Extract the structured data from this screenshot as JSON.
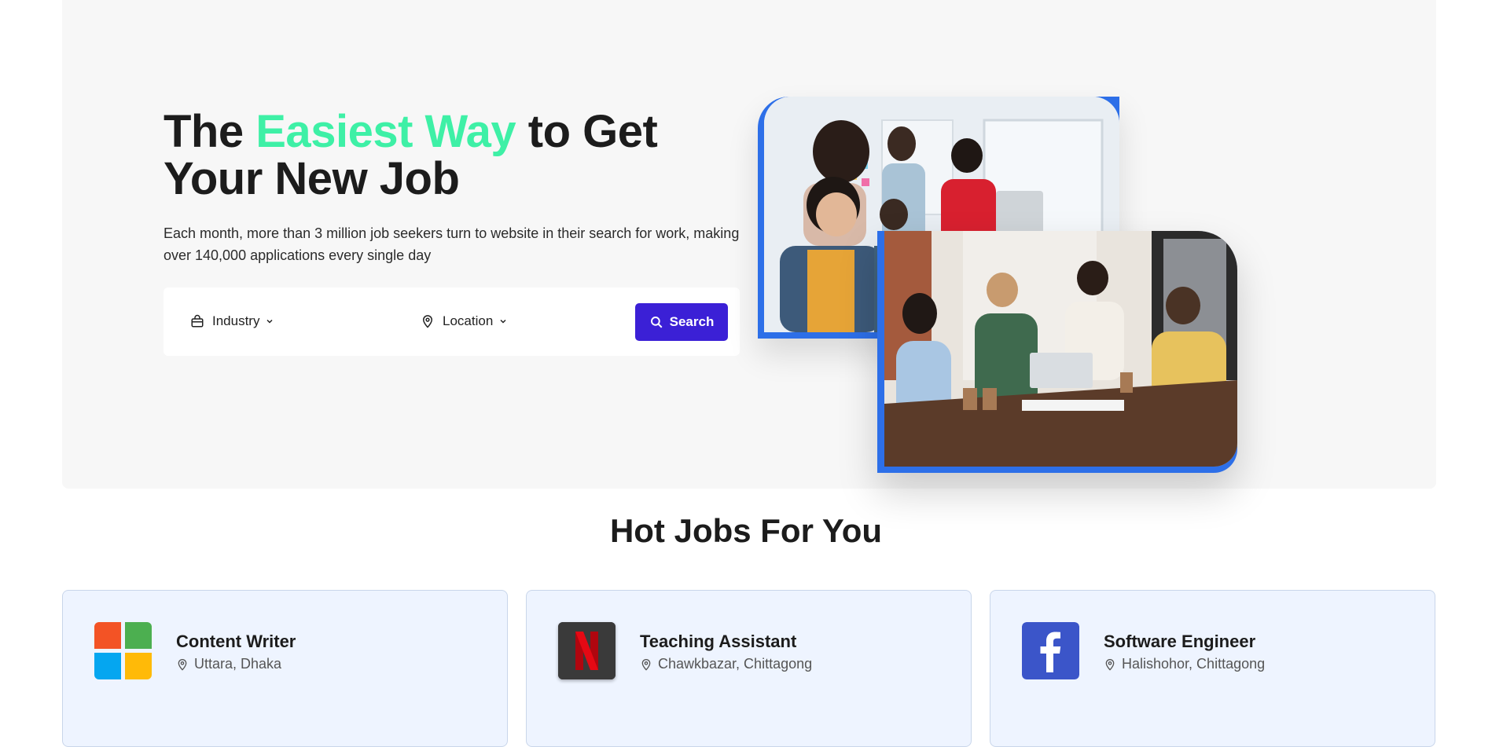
{
  "hero": {
    "headline_before": "The",
    "headline_accent": "Easiest Way",
    "headline_after": "to Get Your New Job",
    "subtext": "Each month, more than 3 million job seekers turn to website in their search for work, making over 140,000 applications every single day"
  },
  "search": {
    "industry_label": "Industry",
    "location_label": "Location",
    "button_label": "Search"
  },
  "hot_jobs": {
    "title": "Hot Jobs For You",
    "jobs": [
      {
        "title": "Content Writer",
        "location": "Uttara, Dhaka",
        "company_icon": "microsoft-logo"
      },
      {
        "title": "Teaching Assistant",
        "location": "Chawkbazar, Chittagong",
        "company_icon": "netflix-logo"
      },
      {
        "title": "Software Engineer",
        "location": "Halishohor, Chittagong",
        "company_icon": "facebook-logo"
      }
    ]
  },
  "colors": {
    "accent_green": "#3ef0a6",
    "primary_button": "#3b20d6",
    "photo_frame": "#2d6fe8",
    "card_bg": "#eef4ff"
  }
}
